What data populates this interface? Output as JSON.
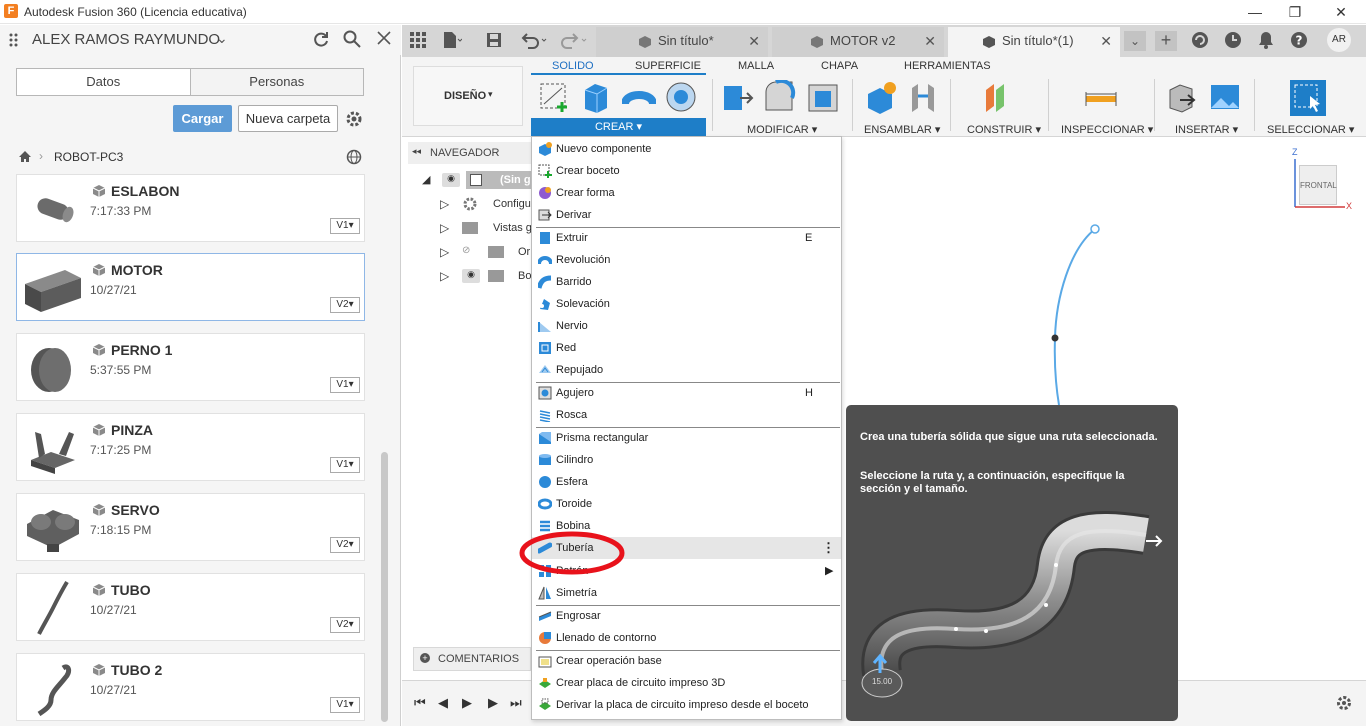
{
  "window": {
    "title": "Autodesk Fusion 360 (Licencia educativa)",
    "logo_letter": "F"
  },
  "left_panel": {
    "user": "ALEX RAMOS RAYMUNDO",
    "tabs": [
      "Datos",
      "Personas"
    ],
    "upload_label": "Cargar",
    "new_folder_label": "Nueva carpeta",
    "breadcrumb": "ROBOT-PC3",
    "files": [
      {
        "name": "ESLABON",
        "date": "7:17:33 PM",
        "version": "V1"
      },
      {
        "name": "MOTOR",
        "date": "10/27/21",
        "version": "V2"
      },
      {
        "name": "PERNO 1",
        "date": "5:37:55 PM",
        "version": "V1"
      },
      {
        "name": "PINZA",
        "date": "7:17:25 PM",
        "version": "V1"
      },
      {
        "name": "SERVO",
        "date": "7:18:15 PM",
        "version": "V2"
      },
      {
        "name": "TUBO",
        "date": "10/27/21",
        "version": "V2"
      },
      {
        "name": "TUBO 2",
        "date": "10/27/21",
        "version": "V1"
      }
    ]
  },
  "doc_tabs": [
    "Sin título*",
    "MOTOR v2",
    "Sin título*(1)"
  ],
  "user_initials": "AR",
  "toolbar": {
    "workspace": "DISEÑO",
    "tabs": [
      "SOLIDO",
      "SUPERFICIE",
      "MALLA",
      "CHAPA",
      "HERRAMIENTAS"
    ],
    "groups": [
      "CREAR",
      "MODIFICAR",
      "ENSAMBLAR",
      "CONSTRUIR",
      "INSPECCIONAR",
      "INSERTAR",
      "SELECCIONAR"
    ]
  },
  "navigator": {
    "title": "NAVEGADOR",
    "items": [
      "(Sin g",
      "Configu",
      "Vistas g",
      "Or",
      "Bo"
    ]
  },
  "comments_label": "COMENTARIOS",
  "viewcube_label": "FRONTAL",
  "axis": {
    "z": "Z",
    "x": "X"
  },
  "menu": {
    "items": [
      {
        "label": "Nuevo componente",
        "shortcut": "",
        "icon": "new-component-icon"
      },
      {
        "label": "Crear boceto",
        "shortcut": "",
        "icon": "sketch-icon"
      },
      {
        "label": "Crear forma",
        "shortcut": "",
        "icon": "form-icon"
      },
      {
        "label": "Derivar",
        "shortcut": "",
        "icon": "derive-icon"
      },
      {
        "label": "Extruir",
        "shortcut": "E",
        "icon": "extrude-icon"
      },
      {
        "label": "Revolución",
        "shortcut": "",
        "icon": "revolve-icon"
      },
      {
        "label": "Barrido",
        "shortcut": "",
        "icon": "sweep-icon"
      },
      {
        "label": "Solevación",
        "shortcut": "",
        "icon": "loft-icon"
      },
      {
        "label": "Nervio",
        "shortcut": "",
        "icon": "rib-icon"
      },
      {
        "label": "Red",
        "shortcut": "",
        "icon": "web-icon"
      },
      {
        "label": "Repujado",
        "shortcut": "",
        "icon": "emboss-icon"
      },
      {
        "label": "Agujero",
        "shortcut": "H",
        "icon": "hole-icon"
      },
      {
        "label": "Rosca",
        "shortcut": "",
        "icon": "thread-icon"
      },
      {
        "label": "Prisma rectangular",
        "shortcut": "",
        "icon": "box-icon"
      },
      {
        "label": "Cilindro",
        "shortcut": "",
        "icon": "cylinder-icon"
      },
      {
        "label": "Esfera",
        "shortcut": "",
        "icon": "sphere-icon"
      },
      {
        "label": "Toroide",
        "shortcut": "",
        "icon": "torus-icon"
      },
      {
        "label": "Bobina",
        "shortcut": "",
        "icon": "coil-icon"
      },
      {
        "label": "Tubería",
        "shortcut": "",
        "icon": "pipe-icon"
      },
      {
        "label": "Patrón",
        "shortcut": "",
        "icon": "pattern-icon"
      },
      {
        "label": "Simetría",
        "shortcut": "",
        "icon": "mirror-icon"
      },
      {
        "label": "Engrosar",
        "shortcut": "",
        "icon": "thicken-icon"
      },
      {
        "label": "Llenado de contorno",
        "shortcut": "",
        "icon": "boundary-fill-icon"
      },
      {
        "label": "Crear operación base",
        "shortcut": "",
        "icon": "base-feature-icon"
      },
      {
        "label": "Crear placa de circuito impreso 3D",
        "shortcut": "",
        "icon": "pcb-icon"
      },
      {
        "label": "Derivar la placa de circuito impreso desde el boceto",
        "shortcut": "",
        "icon": "pcb-sketch-icon"
      }
    ]
  },
  "tooltip": {
    "line1": "Crea una tubería sólida que sigue una ruta seleccionada.",
    "line2": "Seleccione la ruta y, a continuación, especifique la sección y el tamaño.",
    "dimension": "15.00"
  },
  "colors": {
    "accent": "#1e7ec8",
    "highlight_ring": "#e8121b",
    "panel_bg": "#f5f5f5",
    "tooltip_bg": "#4f4f4f"
  }
}
